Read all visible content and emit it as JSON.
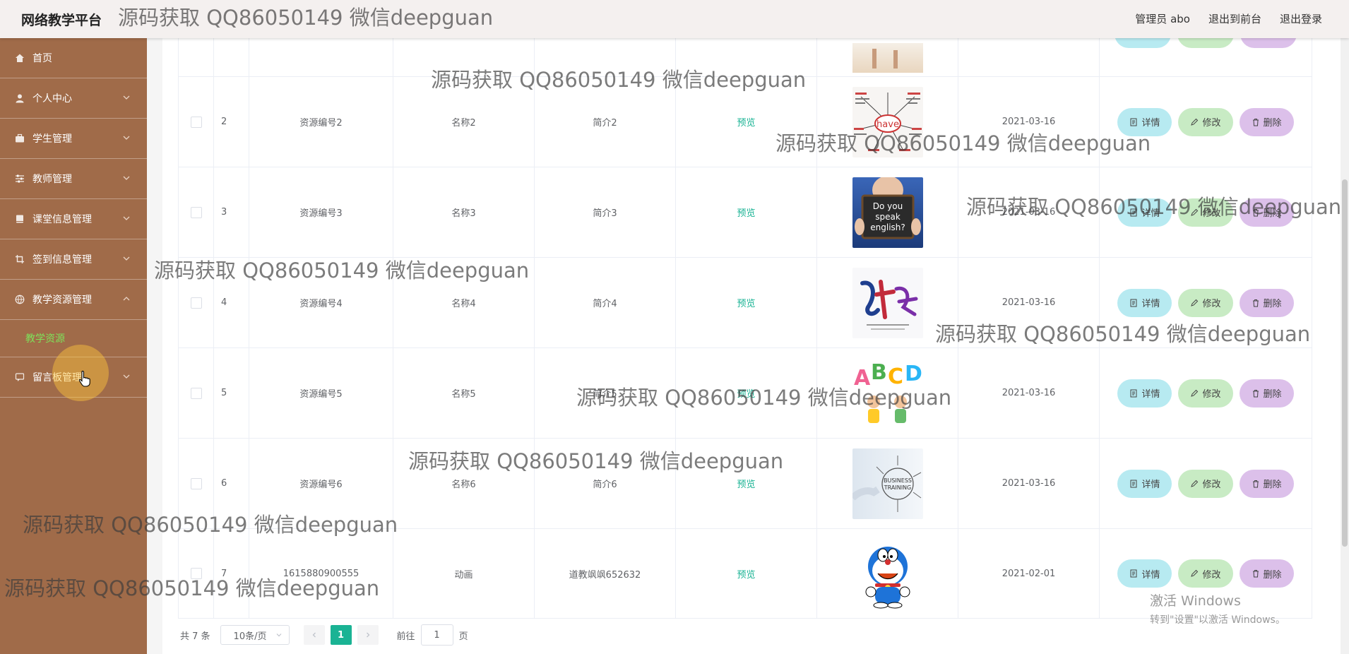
{
  "header": {
    "brand": "网络教学平台",
    "nav": [
      "管理员 abo",
      "退出到前台",
      "退出登录"
    ]
  },
  "sidebar": {
    "items": [
      {
        "label": "首页",
        "icon": "home-icon",
        "chevron": false
      },
      {
        "label": "个人中心",
        "icon": "user-icon",
        "chevron": true
      },
      {
        "label": "学生管理",
        "icon": "briefcase-icon",
        "chevron": true
      },
      {
        "label": "教师管理",
        "icon": "sliders-icon",
        "chevron": true
      },
      {
        "label": "课堂信息管理",
        "icon": "book-icon",
        "chevron": true
      },
      {
        "label": "签到信息管理",
        "icon": "crop-icon",
        "chevron": true
      },
      {
        "label": "教学资源管理",
        "icon": "globe-icon",
        "chevron": true,
        "expanded": true
      },
      {
        "label": "留言板管理",
        "icon": "message-icon",
        "chevron": true
      }
    ],
    "submenu": {
      "label": "教学资源",
      "color": "#7ee25a"
    }
  },
  "table": {
    "preview_label": "预览",
    "buttons": {
      "detail": "详情",
      "edit": "修改",
      "delete": "删除"
    },
    "rows": [
      {
        "idx": "2",
        "code": "资源编号2",
        "name": "名称2",
        "intro": "简介2",
        "date": "2021-03-16",
        "image": "have-mindmap"
      },
      {
        "idx": "3",
        "code": "资源编号3",
        "name": "名称3",
        "intro": "简介3",
        "date": "2021-03-16",
        "image": "do-you-speak-english-sign"
      },
      {
        "idx": "4",
        "code": "资源编号4",
        "name": "名称4",
        "intro": "简介4",
        "date": "2021-03-16",
        "image": "calligraphy-poster"
      },
      {
        "idx": "5",
        "code": "资源编号5",
        "name": "名称5",
        "intro": "简介5",
        "date": "2021-03-16",
        "image": "abcd-kids"
      },
      {
        "idx": "6",
        "code": "资源编号6",
        "name": "名称6",
        "intro": "简介6",
        "date": "2021-03-16",
        "image": "business-training"
      },
      {
        "idx": "7",
        "code": "1615880900555",
        "name": "动画",
        "intro": "道教飒飒652632",
        "date": "2021-02-01",
        "image": "doraemon"
      }
    ]
  },
  "pagination": {
    "total": "共 7 条",
    "page_size": "10条/页",
    "current": "1",
    "goto_label": "前往",
    "goto_value": "1",
    "page_unit": "页"
  },
  "watermark": "源码获取 QQ86050149 微信deepguan",
  "windows_activation": {
    "line1": "激活 Windows",
    "line2": "转到\"设置\"以激活 Windows。"
  },
  "colors": {
    "sidebar": "#a06b49",
    "accent": "#1ab394",
    "detail": "#b7eaf1",
    "edit": "#c8ebc4",
    "delete": "#dcc0ea"
  }
}
